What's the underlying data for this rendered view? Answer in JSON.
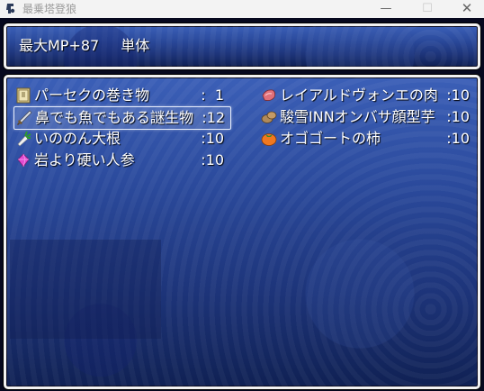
{
  "window": {
    "title": "最乗塔登狼",
    "minimize": "—",
    "maximize": "☐",
    "close": "✕"
  },
  "help": {
    "effect": "最大MP+87",
    "scope": "単体"
  },
  "items": [
    {
      "name": "パーセクの巻き物",
      "count": ":  1",
      "icon": "scroll-icon"
    },
    {
      "name": "鼻でも魚でもある謎生物",
      "count": ":12",
      "icon": "sword-icon"
    },
    {
      "name": "いののん大根",
      "count": ":10",
      "icon": "radish-icon"
    },
    {
      "name": "岩より硬い人参",
      "count": ":10",
      "icon": "gem-icon"
    },
    {
      "name": "レイアルドヴォンエの肉",
      "count": ":10",
      "icon": "meat-icon"
    },
    {
      "name": "駿雪INNオンバサ顔型芋",
      "count": ":10",
      "icon": "potato-icon"
    },
    {
      "name": "オゴゴートの柿",
      "count": ":10",
      "icon": "persimmon-icon"
    }
  ],
  "selected_index": 1,
  "colors": {
    "window_top": "#3b5fb7",
    "window_bottom": "#102154",
    "border": "#f2f2f2",
    "text": "#ffffff"
  }
}
